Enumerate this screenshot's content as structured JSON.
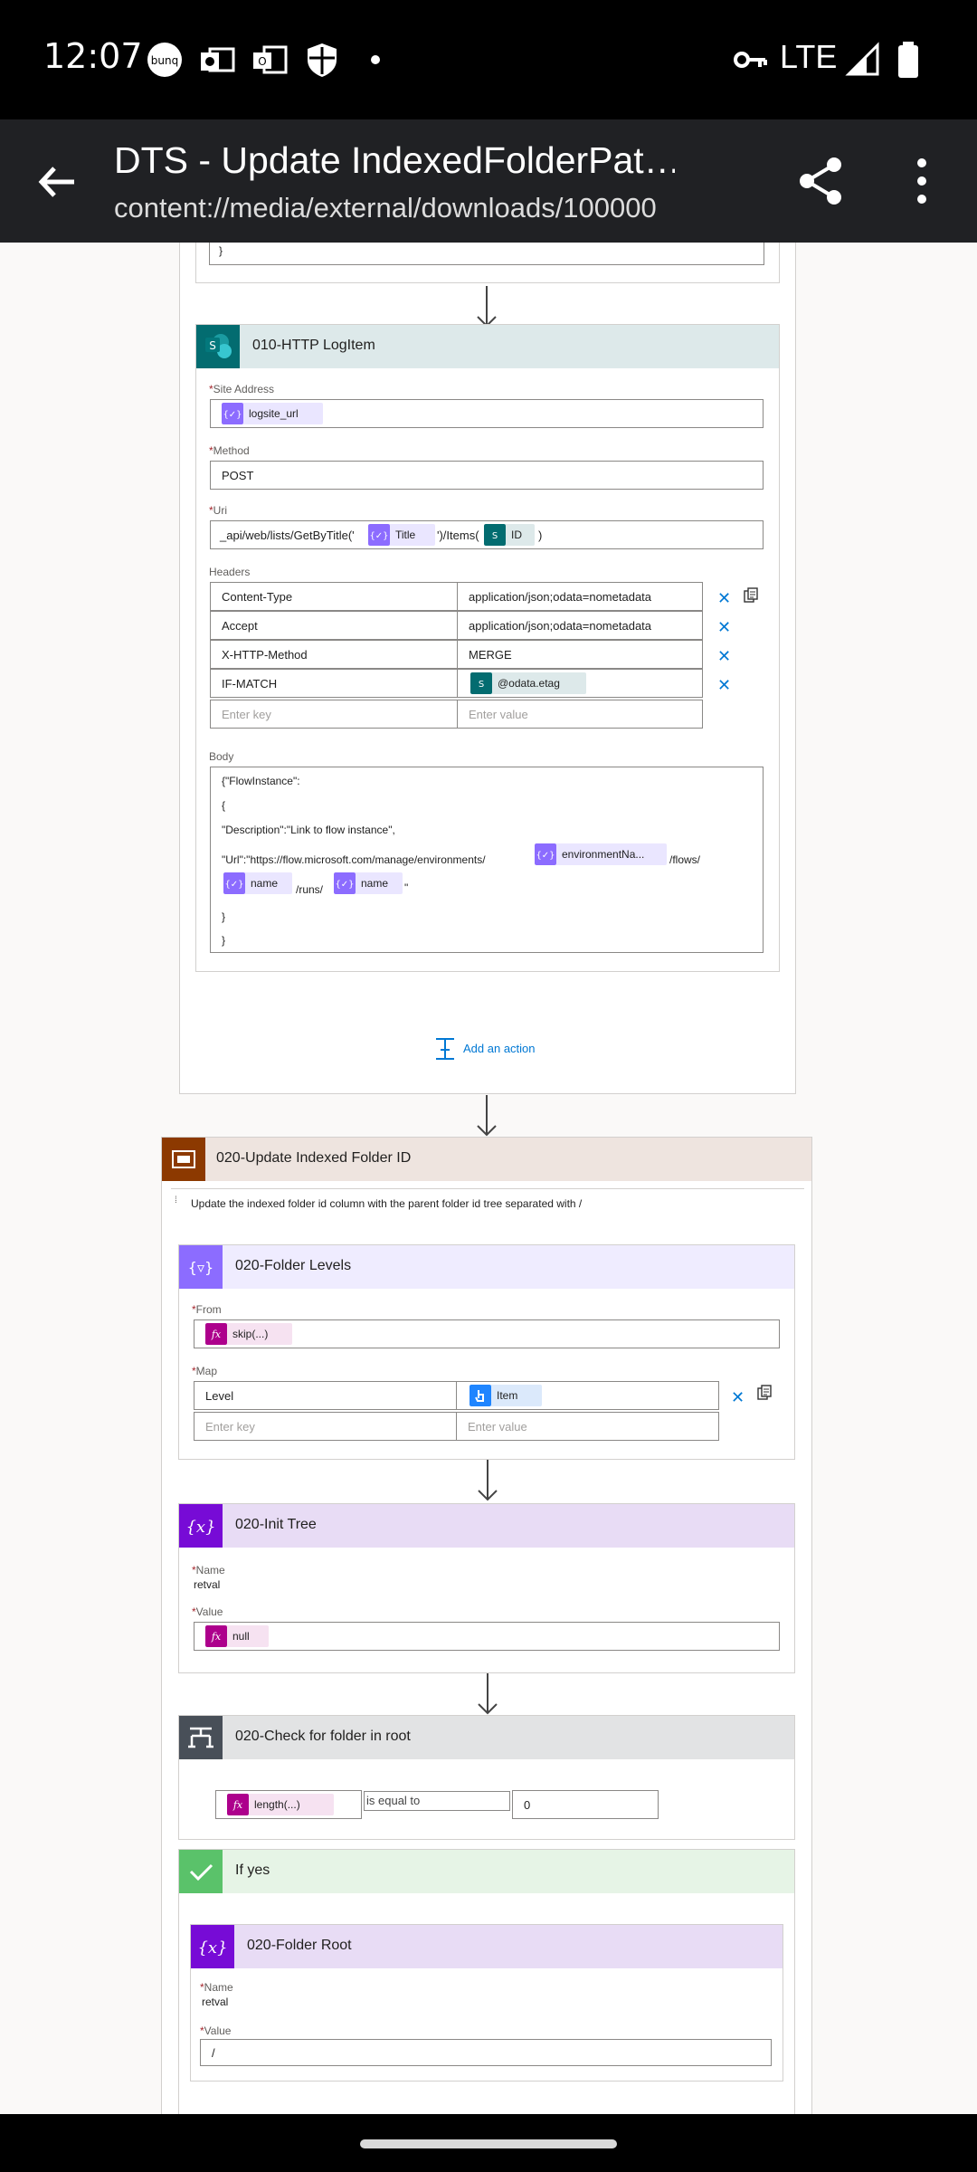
{
  "status_bar": {
    "time": "12:07",
    "network": "LTE",
    "icons": [
      "bunq-icon",
      "outlook-icon",
      "office-icon",
      "shield-icon",
      "dot-icon",
      "vpn-key-icon",
      "signal-icon",
      "battery-icon"
    ]
  },
  "app_bar": {
    "title": "DTS - Update IndexedFolderPat…",
    "subtitle": "content://media/external/downloads/100000"
  },
  "http_action": {
    "title": "010-HTTP LogItem",
    "site_address_label": "Site Address",
    "site_address_token": "logsite_url",
    "method_label": "Method",
    "method_value": "POST",
    "uri_label": "Uri",
    "uri_prefix": "_api/web/lists/GetByTitle('",
    "uri_token1": "Title",
    "uri_mid": "')/Items(",
    "uri_token2": "ID",
    "uri_suffix": ")",
    "headers_label": "Headers",
    "headers": [
      {
        "key": "Content-Type",
        "value": "application/json;odata=nometadata"
      },
      {
        "key": "Accept",
        "value": "application/json;odata=nometadata"
      },
      {
        "key": "X-HTTP-Method",
        "value": "MERGE"
      },
      {
        "key": "IF-MATCH",
        "value": "@odata.etag"
      }
    ],
    "key_placeholder": "Enter key",
    "value_placeholder": "Enter value",
    "body_label": "Body",
    "body_line1": "{\"FlowInstance\":",
    "body_line2": "{",
    "body_line3": "\"Description\":\"Link to flow instance\",",
    "body_line4_prefix": "\"Url\":\"https://flow.microsoft.com/manage/environments/",
    "body_token_env": "environmentNa...",
    "body_line4_suffix": "/flows/",
    "body_token_name1": "name",
    "body_runs": "/runs/",
    "body_token_name2": "name",
    "body_quote": "\"",
    "body_line6": "}",
    "body_line7": "}"
  },
  "add_action": "Add an action",
  "scope": {
    "title": "020-Update Indexed Folder ID",
    "comment": "Update the indexed folder id column with the parent folder id tree separated with /"
  },
  "select_action": {
    "title": "020-Folder Levels",
    "from_label": "From",
    "from_token": "skip(...)",
    "map_label": "Map",
    "map_key": "Level",
    "map_value_token": "Item",
    "key_placeholder": "Enter key",
    "value_placeholder": "Enter value"
  },
  "init_action": {
    "title": "020-Init Tree",
    "name_label": "Name",
    "name_value": "retval",
    "value_label": "Value",
    "value_token": "null"
  },
  "condition": {
    "title": "020-Check for folder in root",
    "left_token": "length(...)",
    "operator": "is equal to",
    "right_value": "0"
  },
  "if_yes": {
    "title": "If yes"
  },
  "folder_root": {
    "title": "020-Folder Root",
    "name_label": "Name",
    "name_value": "retval",
    "value_label": "Value",
    "value_value": "/"
  },
  "colors": {
    "sharepoint": "#036c70",
    "variable": "#770bd6",
    "expression": "#ad008c",
    "data_op": "#8c6cff",
    "scope": "#8c3900",
    "condition": "#484f58",
    "yes": "#5ac26a"
  }
}
